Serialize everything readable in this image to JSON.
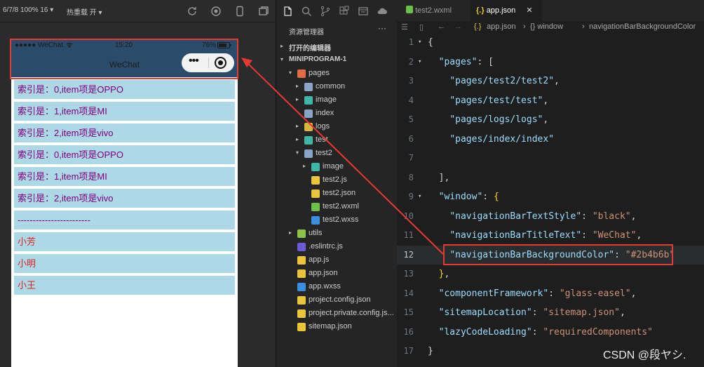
{
  "simulator": {
    "toolbar_device": "6/7/8 100% 16",
    "toolbar_reload": "热重载 开",
    "status_left": "●●●●● WeChat",
    "status_time": "15:20",
    "status_battery": "76%",
    "nav_title": "WeChat",
    "nav_bg": "#2b4b6b",
    "rows": [
      {
        "text": "索引是：0,item项是OPPO",
        "color": "purple"
      },
      {
        "text": "索引是：1,item项是MI",
        "color": "purple"
      },
      {
        "text": "索引是：2,item项是vivo",
        "color": "purple"
      },
      {
        "text": "索引是：0,item项是OPPO",
        "color": "purple"
      },
      {
        "text": "索引是：1,item项是MI",
        "color": "purple"
      },
      {
        "text": "索引是：2,item项是vivo",
        "color": "purple"
      },
      {
        "text": "------------------------",
        "color": "purple"
      },
      {
        "text": "小芳",
        "color": "red"
      },
      {
        "text": "小明",
        "color": "red"
      },
      {
        "text": "小王",
        "color": "red"
      }
    ]
  },
  "explorer": {
    "title": "资源管理器",
    "more": "···",
    "open_editors": "打开的编辑器",
    "project": "MINIPROGRAM-1",
    "tree": [
      {
        "label": "pages",
        "depth": 1,
        "arrow": "▾",
        "icon": "folder-red-icon",
        "color": "#e06c4a"
      },
      {
        "label": "common",
        "depth": 2,
        "arrow": "▸",
        "icon": "folder-icon",
        "color": "#8aa4c8"
      },
      {
        "label": "image",
        "depth": 2,
        "arrow": "▸",
        "icon": "folder-image-icon",
        "color": "#3fb6a8"
      },
      {
        "label": "index",
        "depth": 2,
        "arrow": "",
        "icon": "folder-icon",
        "color": "#8aa4c8"
      },
      {
        "label": "logs",
        "depth": 2,
        "arrow": "▸",
        "icon": "folder-logs-icon",
        "color": "#d8b63c"
      },
      {
        "label": "test",
        "depth": 2,
        "arrow": "▸",
        "icon": "folder-test-icon",
        "color": "#3fb6a8"
      },
      {
        "label": "test2",
        "depth": 2,
        "arrow": "▾",
        "icon": "folder-icon",
        "color": "#8aa4c8"
      },
      {
        "label": "image",
        "depth": 3,
        "arrow": "▸",
        "icon": "folder-image-icon",
        "color": "#3fb6a8"
      },
      {
        "label": "test2.js",
        "depth": 3,
        "arrow": "",
        "icon": "js-file-icon",
        "color": "#e8c53a"
      },
      {
        "label": "test2.json",
        "depth": 3,
        "arrow": "",
        "icon": "json-file-icon",
        "color": "#e8c53a"
      },
      {
        "label": "test2.wxml",
        "depth": 3,
        "arrow": "",
        "icon": "wxml-file-icon",
        "color": "#6cbf4a"
      },
      {
        "label": "test2.wxss",
        "depth": 3,
        "arrow": "",
        "icon": "wxss-file-icon",
        "color": "#3b8fe0"
      },
      {
        "label": "utils",
        "depth": 1,
        "arrow": "▸",
        "icon": "folder-utils-icon",
        "color": "#8ec14a"
      },
      {
        "label": ".eslintrc.js",
        "depth": 1,
        "arrow": "",
        "icon": "eslint-file-icon",
        "color": "#6b5bd6"
      },
      {
        "label": "app.js",
        "depth": 1,
        "arrow": "",
        "icon": "js-file-icon",
        "color": "#e8c53a"
      },
      {
        "label": "app.json",
        "depth": 1,
        "arrow": "",
        "icon": "json-file-icon",
        "color": "#e8c53a"
      },
      {
        "label": "app.wxss",
        "depth": 1,
        "arrow": "",
        "icon": "wxss-file-icon",
        "color": "#3b8fe0"
      },
      {
        "label": "project.config.json",
        "depth": 1,
        "arrow": "",
        "icon": "json-file-icon",
        "color": "#e8c53a"
      },
      {
        "label": "project.private.config.js...",
        "depth": 1,
        "arrow": "",
        "icon": "json-file-icon",
        "color": "#e8c53a"
      },
      {
        "label": "sitemap.json",
        "depth": 1,
        "arrow": "",
        "icon": "json-file-icon",
        "color": "#e8c53a"
      }
    ]
  },
  "editor": {
    "tabs": [
      {
        "label": "test2.wxml",
        "active": false
      },
      {
        "label": "app.json",
        "active": true
      }
    ],
    "tab_close": "✕",
    "breadcrumb": [
      "app.json",
      "{} window",
      "navigationBarBackgroundColor"
    ],
    "lines": [
      {
        "n": "1",
        "tokens": [
          [
            "p",
            "{"
          ]
        ]
      },
      {
        "n": "2",
        "tokens": [
          [
            "p",
            "  "
          ],
          [
            "k",
            "\"pages\""
          ],
          [
            "p",
            ": ["
          ]
        ]
      },
      {
        "n": "3",
        "tokens": [
          [
            "p",
            "    "
          ],
          [
            "s2",
            "\"pages/test2/test2\""
          ],
          [
            "p",
            ","
          ]
        ]
      },
      {
        "n": "4",
        "tokens": [
          [
            "p",
            "    "
          ],
          [
            "s2",
            "\"pages/test/test\""
          ],
          [
            "p",
            ","
          ]
        ]
      },
      {
        "n": "5",
        "tokens": [
          [
            "p",
            "    "
          ],
          [
            "s2",
            "\"pages/logs/logs\""
          ],
          [
            "p",
            ","
          ]
        ]
      },
      {
        "n": "6",
        "tokens": [
          [
            "p",
            "    "
          ],
          [
            "s2",
            "\"pages/index/index\""
          ]
        ]
      },
      {
        "n": "7",
        "tokens": [
          [
            "p",
            ""
          ]
        ]
      },
      {
        "n": "8",
        "tokens": [
          [
            "p",
            "  ],"
          ]
        ]
      },
      {
        "n": "9",
        "tokens": [
          [
            "p",
            "  "
          ],
          [
            "k",
            "\"window\""
          ],
          [
            "p",
            ": "
          ],
          [
            "b",
            "{"
          ]
        ]
      },
      {
        "n": "10",
        "tokens": [
          [
            "p",
            "    "
          ],
          [
            "k",
            "\"navigationBarTextStyle\""
          ],
          [
            "p",
            ": "
          ],
          [
            "s",
            "\"black\""
          ],
          [
            "p",
            ","
          ]
        ]
      },
      {
        "n": "11",
        "tokens": [
          [
            "p",
            "    "
          ],
          [
            "k",
            "\"navigationBarTitleText\""
          ],
          [
            "p",
            ": "
          ],
          [
            "s",
            "\"WeChat\""
          ],
          [
            "p",
            ","
          ]
        ]
      },
      {
        "n": "12",
        "tokens": [
          [
            "p",
            "    "
          ],
          [
            "k",
            "\"navigationBarBackgroundColor\""
          ],
          [
            "p",
            ": "
          ],
          [
            "s",
            "\"#2b4b6b\""
          ]
        ]
      },
      {
        "n": "13",
        "tokens": [
          [
            "p",
            "  "
          ],
          [
            "b",
            "}"
          ],
          [
            "p",
            ","
          ]
        ]
      },
      {
        "n": "14",
        "tokens": [
          [
            "p",
            "  "
          ],
          [
            "k",
            "\"componentFramework\""
          ],
          [
            "p",
            ": "
          ],
          [
            "s",
            "\"glass-easel\""
          ],
          [
            "p",
            ","
          ]
        ]
      },
      {
        "n": "15",
        "tokens": [
          [
            "p",
            "  "
          ],
          [
            "k",
            "\"sitemapLocation\""
          ],
          [
            "p",
            ": "
          ],
          [
            "s",
            "\"sitemap.json\""
          ],
          [
            "p",
            ","
          ]
        ]
      },
      {
        "n": "16",
        "tokens": [
          [
            "p",
            "  "
          ],
          [
            "k",
            "\"lazyCodeLoading\""
          ],
          [
            "p",
            ": "
          ],
          [
            "s",
            "\"requiredComponents\""
          ]
        ]
      },
      {
        "n": "17",
        "tokens": [
          [
            "p",
            "}"
          ]
        ]
      }
    ],
    "current_line": "12"
  },
  "watermark": "CSDN @段ヤシ."
}
